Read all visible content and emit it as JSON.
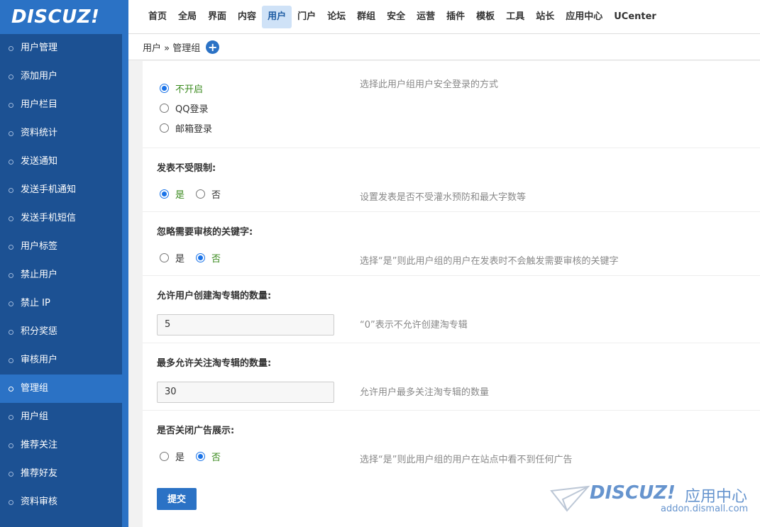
{
  "logo": "DISCUZ!",
  "nav": [
    "首页",
    "全局",
    "界面",
    "内容",
    "用户",
    "门户",
    "论坛",
    "群组",
    "安全",
    "运营",
    "插件",
    "模板",
    "工具",
    "站长",
    "应用中心",
    "UCenter"
  ],
  "nav_active": "用户",
  "sidebar": {
    "items": [
      "用户管理",
      "添加用户",
      "用户栏目",
      "资料统计",
      "发送通知",
      "发送手机通知",
      "发送手机短信",
      "用户标签",
      "禁止用户",
      "禁止 IP",
      "积分奖惩",
      "审核用户",
      "管理组",
      "用户组",
      "推荐关注",
      "推荐好友",
      "资料审核"
    ],
    "active": "管理组"
  },
  "breadcrumb": {
    "path": "用户 » 管理组",
    "add_icon": "+"
  },
  "form": {
    "login": {
      "options": [
        "不开启",
        "QQ登录",
        "邮箱登录"
      ],
      "selected": "不开启",
      "desc": "选择此用户组用户安全登录的方式"
    },
    "post_unlimited": {
      "title": "发表不受限制:",
      "yes": "是",
      "no": "否",
      "selected": "是",
      "desc": "设置发表是否不受灌水预防和最大字数等"
    },
    "ignore_keywords": {
      "title": "忽略需要审核的关键字:",
      "yes": "是",
      "no": "否",
      "selected": "否",
      "desc": "选择“是”则此用户组的用户在发表时不会触发需要审核的关键字"
    },
    "create_album": {
      "title": "允许用户创建淘专辑的数量:",
      "value": "5",
      "desc": "“0”表示不允许创建淘专辑"
    },
    "follow_album": {
      "title": "最多允许关注淘专辑的数量:",
      "value": "30",
      "desc": "允许用户最多关注淘专辑的数量"
    },
    "close_ads": {
      "title": "是否关闭广告展示:",
      "yes": "是",
      "no": "否",
      "selected": "否",
      "desc": "选择“是”则此用户组的用户在站点中看不到任何广告"
    },
    "submit": "提交"
  },
  "watermark": {
    "brand": "DISCUZ!",
    "cn": "应用中心",
    "url": "addon.dismall.com"
  },
  "colors": {
    "primary": "#2b72c5",
    "sidebar": "#1c5193",
    "selected_text": "#3a8a1e"
  }
}
